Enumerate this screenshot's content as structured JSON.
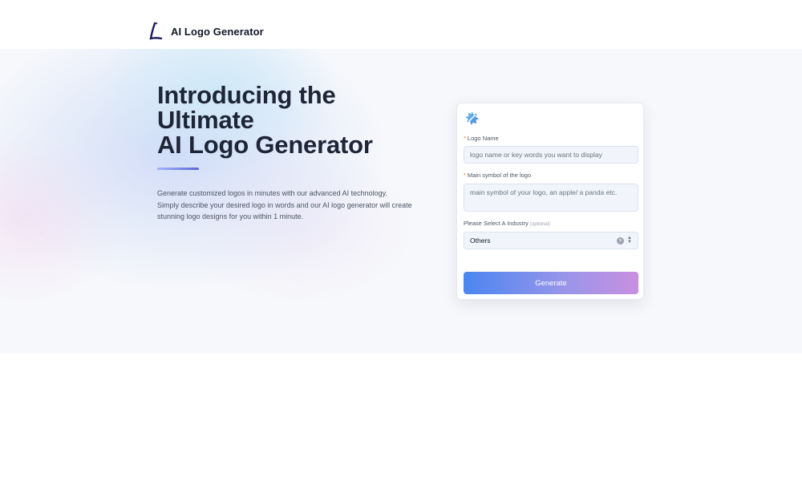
{
  "header": {
    "brand_name": "AI Logo Generator",
    "brand_mark": "pen-stroke-L-logo"
  },
  "hero": {
    "headline_lines": [
      "Introducing the",
      "Ultimate",
      "AI Logo Generator"
    ],
    "description_lines": [
      "Generate customized logos in minutes with our advanced AI technology.",
      "Simply describe your desired logo in words and our AI logo generator will create",
      "stunning logo designs for you within 1 minute."
    ]
  },
  "form": {
    "icon": "magic-wand-icon",
    "logo_name": {
      "required_mark": "*",
      "label": "Logo Name",
      "placeholder": "logo name or key words you want to display",
      "value": ""
    },
    "symbol": {
      "required_mark": "*",
      "label": "Main symbol of the logo",
      "placeholder": "main symbol of your logo, an apple/ a panda etc.",
      "value": ""
    },
    "industry": {
      "label": "Please Select A Industry",
      "optional": "(optional)",
      "selected": "Others"
    },
    "generate_label": "Generate"
  },
  "colors": {
    "accent_start": "#4a86f0",
    "accent_end": "#c88fe0",
    "required": "#f97316",
    "headline": "#1e2538"
  }
}
